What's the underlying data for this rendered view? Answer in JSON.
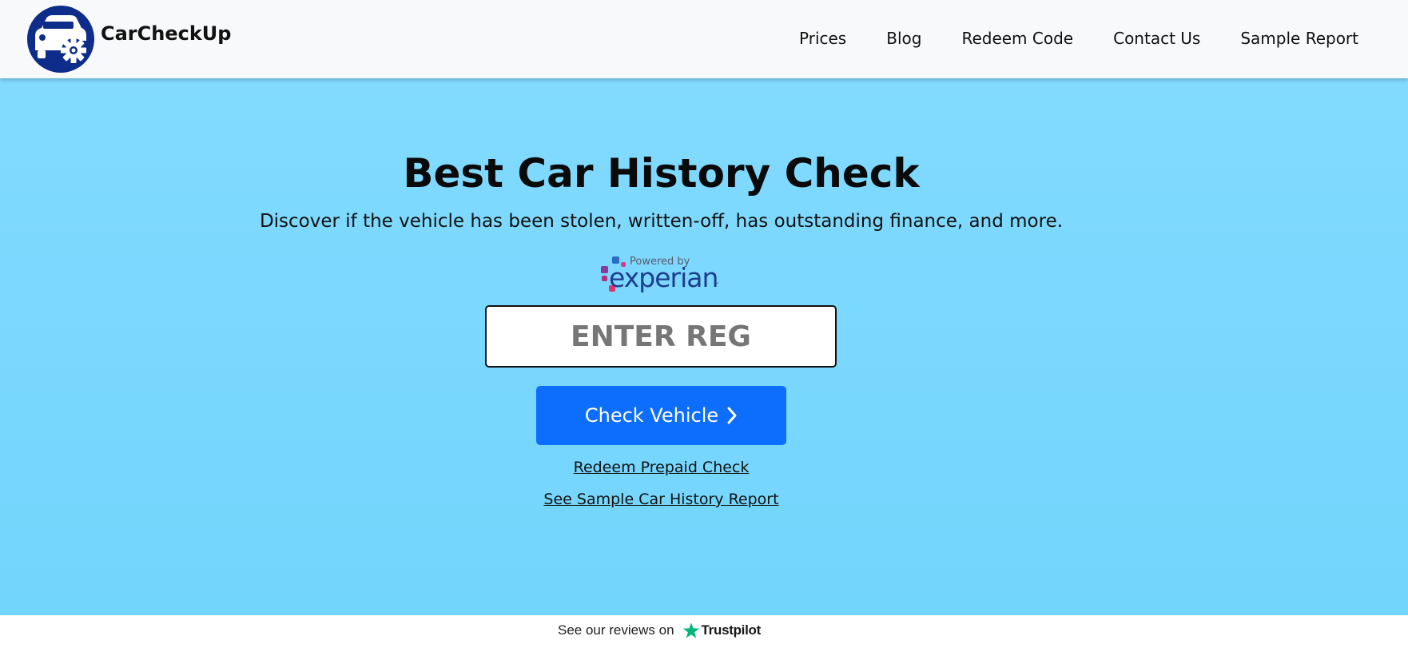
{
  "brand": {
    "name": "CarCheckUp",
    "logo_color": "#0e2d8a"
  },
  "nav": {
    "items": [
      {
        "label": "Prices"
      },
      {
        "label": "Blog"
      },
      {
        "label": "Redeem Code"
      },
      {
        "label": "Contact Us"
      },
      {
        "label": "Sample Report"
      }
    ]
  },
  "hero": {
    "title": "Best Car History Check",
    "subtitle": "Discover if the vehicle has been stolen, written-off, has outstanding finance, and more.",
    "powered_by": "Powered by",
    "partner": "experian",
    "partner_mark": "™",
    "reg_placeholder": "ENTER REG",
    "reg_value": "",
    "check_button_label": "Check Vehicle",
    "check_button_icon": "chevron-right-icon",
    "redeem_link": "Redeem Prepaid Check",
    "sample_link": "See Sample Car History Report",
    "background_color": "#7ad8fe",
    "button_color": "#0d6efd"
  },
  "footer": {
    "reviews_text": "See our reviews on",
    "trustpilot_label": "Trustpilot",
    "star_icon": "star-icon",
    "star_color": "#00b67a"
  }
}
